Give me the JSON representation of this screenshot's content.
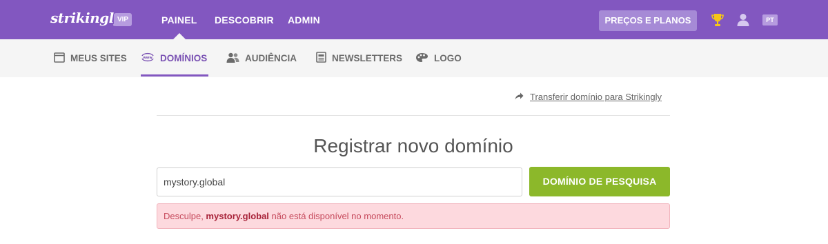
{
  "brand": {
    "logo_text": "strikingly",
    "vip_badge": "VIP"
  },
  "top_nav": {
    "items": [
      {
        "label": "PAINEL",
        "active": true
      },
      {
        "label": "DESCOBRIR",
        "active": false
      },
      {
        "label": "ADMIN",
        "active": false
      }
    ],
    "pricing_label": "PREÇOS E PLANOS",
    "language": "PT"
  },
  "sub_nav": {
    "items": [
      {
        "label": "MEUS SITES",
        "icon": "browser-window-icon",
        "active": false
      },
      {
        "label": "DOMÍNIOS",
        "icon": "www-globe-icon",
        "active": true
      },
      {
        "label": "AUDIÊNCIA",
        "icon": "people-icon",
        "active": false
      },
      {
        "label": "NEWSLETTERS",
        "icon": "newsletter-icon",
        "active": false
      },
      {
        "label": "LOGO",
        "icon": "palette-icon",
        "active": false
      }
    ]
  },
  "transfer_link": "Transferir domínio para Strikingly",
  "page_title": "Registrar novo domínio",
  "search": {
    "value": "mystory.global",
    "button_label": "DOMÍNIO DE PESQUISA"
  },
  "alert": {
    "prefix": "Desculpe, ",
    "domain": "mystory.global",
    "suffix": " não está disponível no momento."
  },
  "colors": {
    "topbar": "#8257c0",
    "active_accent": "#7a52b3",
    "search_button": "#8cb82a",
    "alert_background": "#fdd9de",
    "alert_text": "#c64a5c"
  }
}
